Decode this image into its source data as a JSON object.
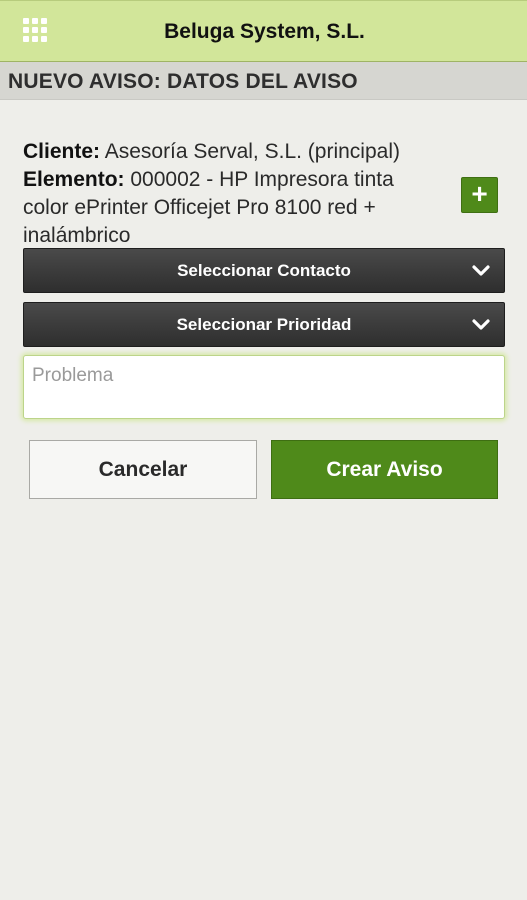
{
  "header": {
    "title": "Beluga System, S.L.",
    "menu_icon": "apps-grid-icon"
  },
  "section": {
    "title": "NUEVO AVISO: DATOS DEL AVISO"
  },
  "details": {
    "cliente_label": "Cliente:",
    "cliente_value": "Asesoría Serval, S.L. (principal)",
    "elemento_label": "Elemento:",
    "elemento_value": "000002 - HP Impresora tinta color ePrinter Officejet Pro 8100 red + inalámbrico",
    "add_button_label": "+"
  },
  "selects": {
    "contacto": "Seleccionar Contacto",
    "prioridad": "Seleccionar Prioridad"
  },
  "problem": {
    "placeholder": "Problema",
    "value": ""
  },
  "actions": {
    "cancel_label": "Cancelar",
    "create_label": "Crear Aviso"
  },
  "colors": {
    "header_bg": "#d2e69a",
    "accent_green": "#4f8a1a",
    "select_bg": "#333333",
    "page_bg": "#eeeeea"
  }
}
